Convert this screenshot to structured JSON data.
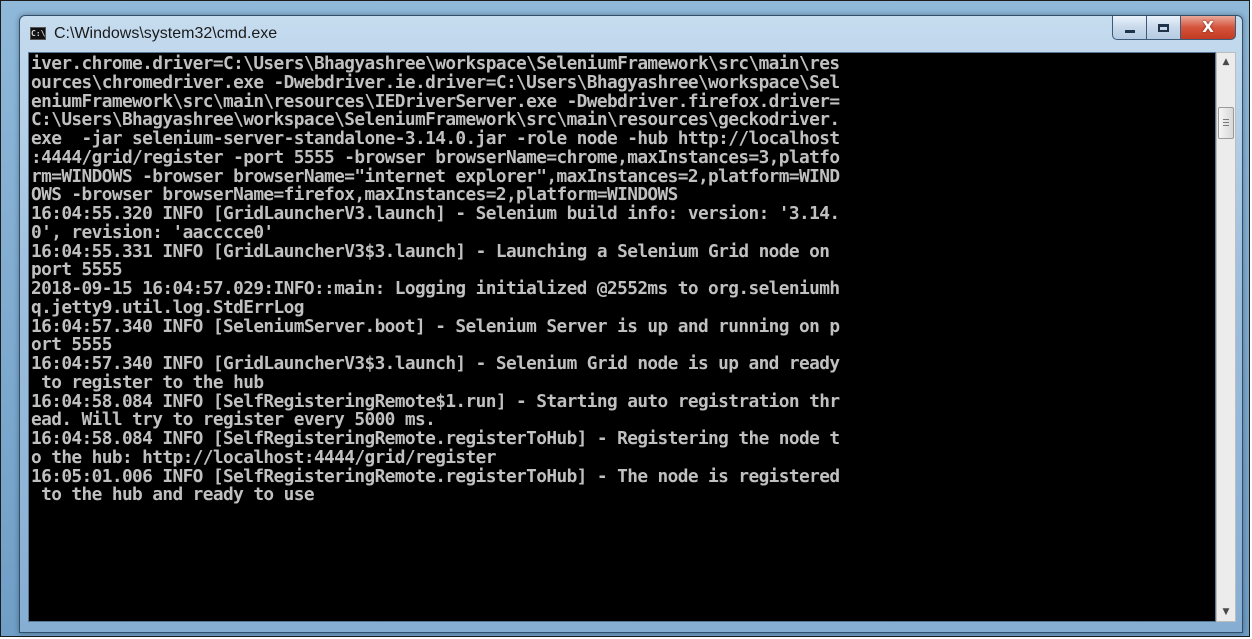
{
  "window": {
    "title": "C:\\Windows\\system32\\cmd.exe",
    "icon_label": "C:\\"
  },
  "caption_buttons": {
    "minimize_icon": "minimize-icon",
    "maximize_icon": "maximize-icon",
    "close_glyph": "X"
  },
  "console": {
    "text": "iver.chrome.driver=C:\\Users\\Bhagyashree\\workspace\\SeleniumFramework\\src\\main\\res\nources\\chromedriver.exe -Dwebdriver.ie.driver=C:\\Users\\Bhagyashree\\workspace\\Sel\neniumFramework\\src\\main\\resources\\IEDriverServer.exe -Dwebdriver.firefox.driver=\nC:\\Users\\Bhagyashree\\workspace\\SeleniumFramework\\src\\main\\resources\\geckodriver.\nexe  -jar selenium-server-standalone-3.14.0.jar -role node -hub http://localhost\n:4444/grid/register -port 5555 -browser browserName=chrome,maxInstances=3,platfo\nrm=WINDOWS -browser browserName=\"internet explorer\",maxInstances=2,platform=WIND\nOWS -browser browserName=firefox,maxInstances=2,platform=WINDOWS\n16:04:55.320 INFO [GridLauncherV3.launch] - Selenium build info: version: '3.14.\n0', revision: 'aacccce0'\n16:04:55.331 INFO [GridLauncherV3$3.launch] - Launching a Selenium Grid node on\nport 5555\n2018-09-15 16:04:57.029:INFO::main: Logging initialized @2552ms to org.seleniumh\nq.jetty9.util.log.StdErrLog\n16:04:57.340 INFO [SeleniumServer.boot] - Selenium Server is up and running on p\nort 5555\n16:04:57.340 INFO [GridLauncherV3$3.launch] - Selenium Grid node is up and ready\n to register to the hub\n16:04:58.084 INFO [SelfRegisteringRemote$1.run] - Starting auto registration thr\nead. Will try to register every 5000 ms.\n16:04:58.084 INFO [SelfRegisteringRemote.registerToHub] - Registering the node t\no the hub: http://localhost:4444/grid/register\n16:05:01.006 INFO [SelfRegisteringRemote.registerToHub] - The node is registered\n to the hub and ready to use"
  },
  "scrollbar": {
    "up_icon": "scroll-up-arrow-icon",
    "down_icon": "scroll-down-arrow-icon"
  },
  "colors": {
    "console_bg": "#000000",
    "console_fg": "#c0c0c0"
  }
}
